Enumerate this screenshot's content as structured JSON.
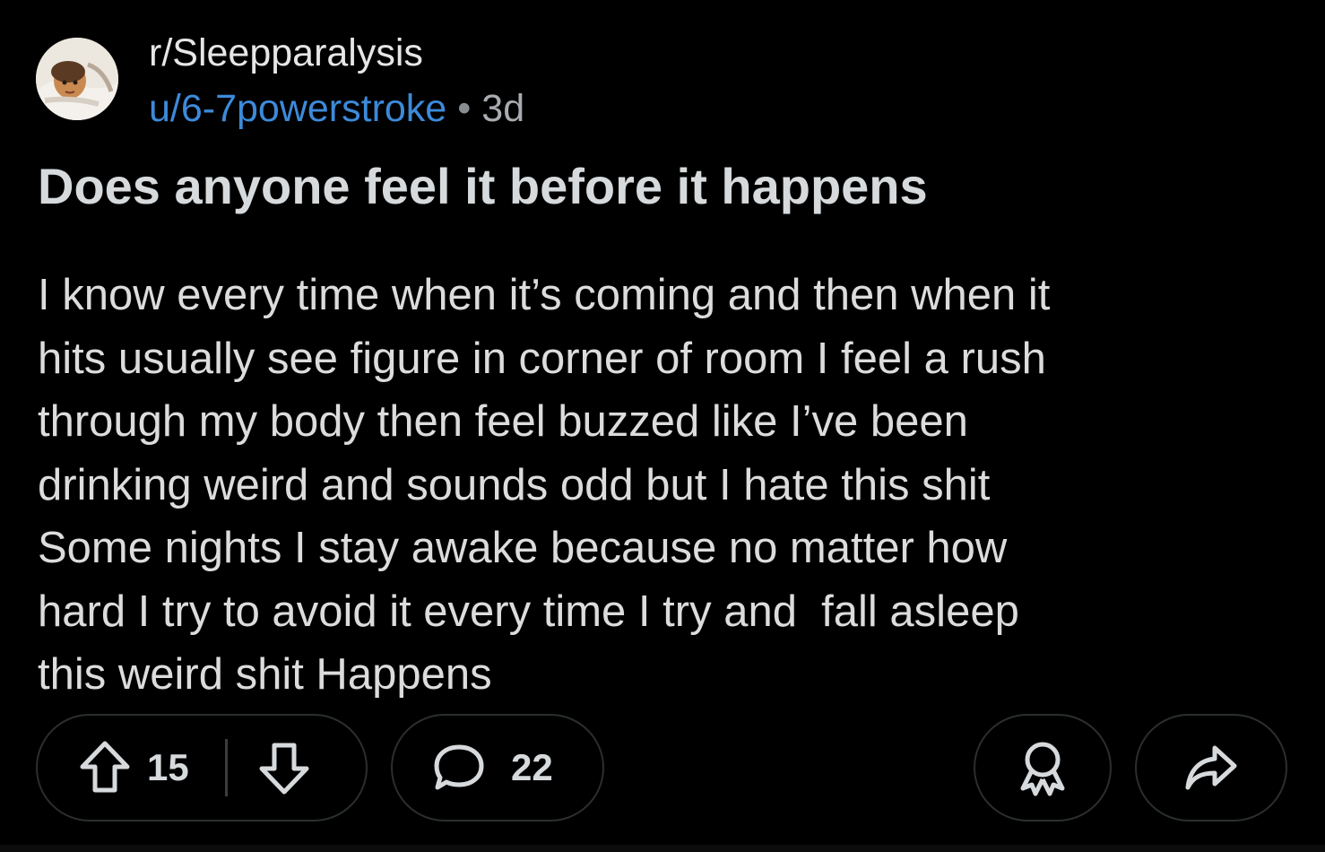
{
  "post": {
    "subreddit": "r/Sleepparalysis",
    "username": "u/6-7powerstroke",
    "separator": "•",
    "age": "3d",
    "title": "Does anyone feel it before it happens",
    "body_lines": [
      "I know every time when it’s coming and then when it",
      "hits usually see figure in corner of room I feel a rush",
      "through my body then feel buzzed like I’ve been",
      "drinking weird and sounds odd but I hate this shit",
      "Some nights I stay awake because no matter how",
      "hard I try to avoid it every time I try and  fall asleep",
      "this weird shit Happens"
    ]
  },
  "actions": {
    "upvote_count": "15",
    "comment_count": "22",
    "icons": {
      "upvote": "arrow-up-outline-icon",
      "downvote": "arrow-down-outline-icon",
      "comment": "speech-bubble-icon",
      "award": "award-ribbon-icon",
      "share": "share-arrow-icon"
    }
  },
  "colors": {
    "background": "#000000",
    "username": "#3d8ad9",
    "text": "#d7dadc",
    "pill_border": "#2b2e30"
  }
}
